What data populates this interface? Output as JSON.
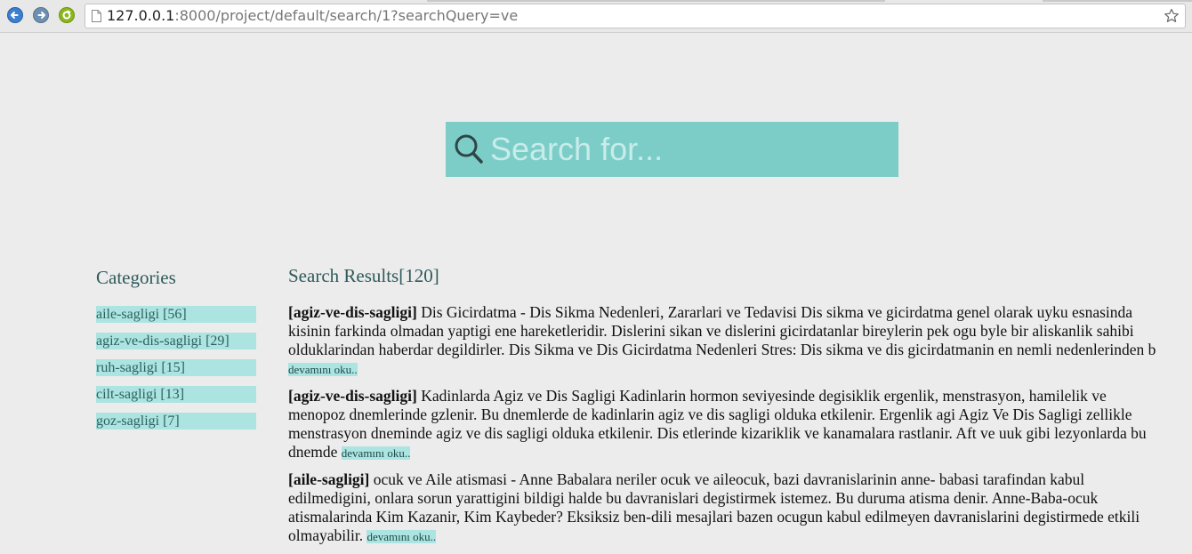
{
  "browser": {
    "url_host": "127.0.0.1",
    "url_rest": ":8000/project/default/search/1?searchQuery=ve"
  },
  "search": {
    "placeholder": "Search for..."
  },
  "categories": {
    "title": "Categories",
    "items": [
      {
        "label": "aile-sagligi [56]"
      },
      {
        "label": "agiz-ve-dis-sagligi [29]"
      },
      {
        "label": "ruh-sagligi [15]"
      },
      {
        "label": "cilt-sagligi [13]"
      },
      {
        "label": "goz-sagligi [7]"
      }
    ]
  },
  "results": {
    "title": "Search Results[120]",
    "read_more_label": "devamını oku..",
    "items": [
      {
        "category": "[agiz-ve-dis-sagligi]",
        "text": " Dis Gicirdatma - Dis Sikma Nedenleri, Zararlari ve Tedavisi Dis sikma ve gicirdatma genel olarak uyku esnasinda kisinin farkinda olmadan yaptigi ene hareketleridir. Dislerini sikan ve dislerini gicirdatanlar bireylerin pek ogu byle bir aliskanlik sahibi olduklarindan haberdar degildirler. Dis Sikma ve Dis Gicirdatma Nedenleri Stres: Dis sikma ve dis gicirdatmanin en nemli nedenlerinden b "
      },
      {
        "category": "[agiz-ve-dis-sagligi]",
        "text": " Kadinlarda Agiz ve Dis Sagligi Kadinlarin hormon seviyesinde degisiklik ergenlik, menstrasyon, hamilelik ve menopoz dnemlerinde gzlenir. Bu dnemlerde de kadinlarin agiz ve dis sagligi olduka etkilenir. Ergenlik agi Agiz Ve Dis Sagligi zellikle menstrasyon dneminde agiz ve dis sagligi olduka etkilenir. Dis etlerinde kizariklik ve kanamalara rastlanir. Aft ve uuk gibi lezyonlarda bu dnemde "
      },
      {
        "category": "[aile-sagligi]",
        "text": " ocuk ve Aile atismasi - Anne Babalara neriler ocuk ve aileocuk, bazi davranislarinin anne- babasi tarafindan kabul edilmedigini, onlara sorun yarattigini bildigi halde bu davranislari degistirmek istemez. Bu duruma atisma denir. Anne-Baba-ocuk atismalarinda Kim Kazanir, Kim Kaybeder? Eksiksiz ben-dili mesajlari bazen ocugun kabul edilmeyen davranislarini degistirmede etkili olmayabilir. "
      }
    ]
  },
  "colors": {
    "accent": "#7ccdc8",
    "tag_bg": "#abe4e1",
    "heading": "#2e5a5a"
  }
}
